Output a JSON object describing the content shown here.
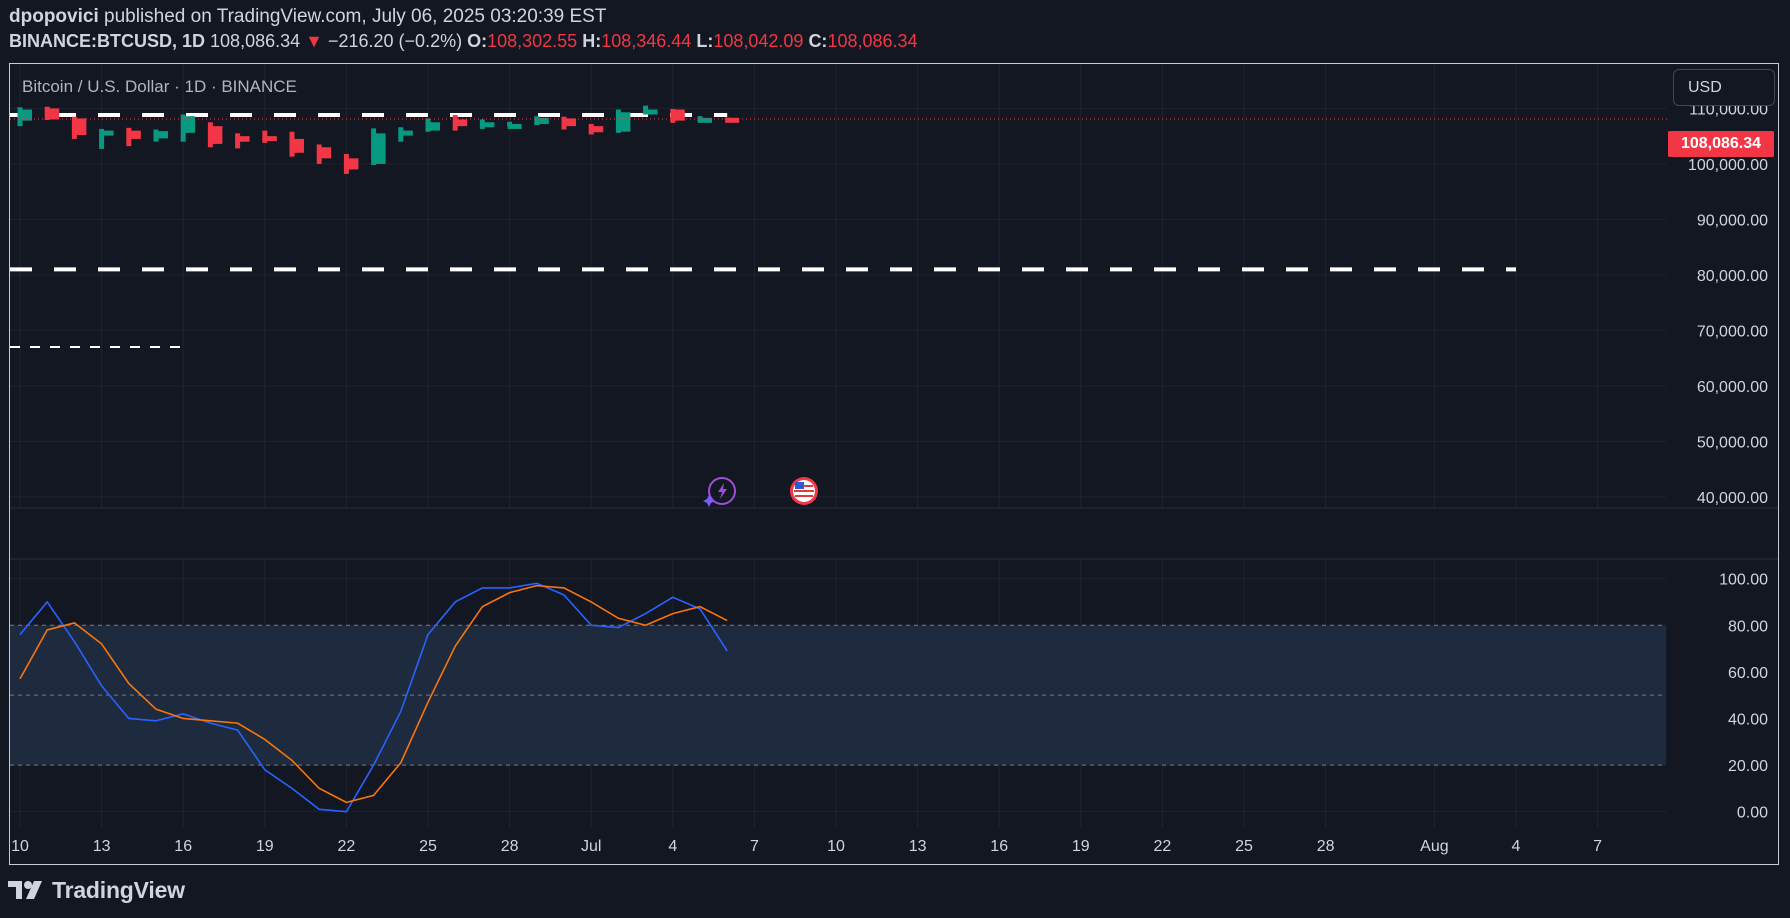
{
  "header": {
    "author": "dpopovici",
    "published_text": "published on TradingView.com, July 06, 2025 03:20:39 EST",
    "symbol": "BINANCE:BTCUSD, 1D",
    "last_price": "108,086.34",
    "arrow": "▼",
    "change": "−216.20 (−0.2%)",
    "open_label": "O:",
    "open": "108,302.55",
    "high_label": "H:",
    "high": "108,346.44",
    "low_label": "L:",
    "low": "108,042.09",
    "close_label": "C:",
    "close": "108,086.34"
  },
  "legend_title": "Bitcoin / U.S. Dollar · 1D · BINANCE",
  "currency_button": "USD",
  "price_tag": "108,086.34",
  "brand": "TradingView",
  "icons": {
    "event1": "lightning-sparkle-icon",
    "event2": "us-flag-icon",
    "logo": "tradingview-logo-icon"
  },
  "colors": {
    "background": "#131722",
    "up": "#089981",
    "down": "#f23645",
    "k_line": "#2962ff",
    "d_line": "#f7760d",
    "band": "#1e2a3d"
  },
  "chart_data": [
    {
      "type": "candlestick",
      "title": "",
      "y_ticks": [
        "110,000.00",
        "100,000.00",
        "90,000.00",
        "80,000.00",
        "70,000.00",
        "60,000.00",
        "50,000.00",
        "40,000.00"
      ],
      "y_tick_values": [
        110000,
        100000,
        90000,
        80000,
        70000,
        60000,
        50000,
        40000
      ],
      "ylim": [
        38000,
        118000
      ],
      "x_ticks": [
        "10",
        "13",
        "16",
        "19",
        "22",
        "25",
        "28",
        "Jul",
        "4",
        "7",
        "10",
        "13",
        "16",
        "19",
        "22",
        "25",
        "28",
        "Aug",
        "4",
        "7"
      ],
      "x_tick_days": [
        0,
        3,
        6,
        9,
        12,
        15,
        18,
        21,
        24,
        27,
        30,
        33,
        36,
        39,
        42,
        45,
        48,
        52,
        55,
        58
      ],
      "candles_start_day": 0,
      "candles": [
        {
          "o": 107800,
          "h": 110200,
          "l": 106800,
          "c": 109800
        },
        {
          "o": 110000,
          "h": 110300,
          "l": 107900,
          "c": 108000
        },
        {
          "o": 108200,
          "h": 108500,
          "l": 104500,
          "c": 105200
        },
        {
          "o": 105200,
          "h": 106300,
          "l": 102700,
          "c": 106000
        },
        {
          "o": 106000,
          "h": 106500,
          "l": 103200,
          "c": 104500
        },
        {
          "o": 104600,
          "h": 106200,
          "l": 104000,
          "c": 105900
        },
        {
          "o": 105600,
          "h": 108900,
          "l": 104000,
          "c": 108600
        },
        {
          "o": 106800,
          "h": 107500,
          "l": 103000,
          "c": 103600
        },
        {
          "o": 105000,
          "h": 105500,
          "l": 102800,
          "c": 104000
        },
        {
          "o": 105000,
          "h": 106000,
          "l": 103800,
          "c": 104200
        },
        {
          "o": 104500,
          "h": 105800,
          "l": 101300,
          "c": 102000
        },
        {
          "o": 103000,
          "h": 103500,
          "l": 100000,
          "c": 101000
        },
        {
          "o": 101000,
          "h": 101800,
          "l": 98200,
          "c": 99000
        },
        {
          "o": 100000,
          "h": 106400,
          "l": 99800,
          "c": 105500
        },
        {
          "o": 105500,
          "h": 106600,
          "l": 104000,
          "c": 106000
        },
        {
          "o": 106000,
          "h": 108200,
          "l": 105800,
          "c": 107500
        },
        {
          "o": 108000,
          "h": 108800,
          "l": 106000,
          "c": 106800
        },
        {
          "o": 106800,
          "h": 108000,
          "l": 106300,
          "c": 107500
        },
        {
          "o": 107000,
          "h": 107600,
          "l": 106800,
          "c": 107200
        },
        {
          "o": 107200,
          "h": 108600,
          "l": 107000,
          "c": 108300
        },
        {
          "o": 108200,
          "h": 108500,
          "l": 106200,
          "c": 106800
        },
        {
          "o": 106800,
          "h": 107200,
          "l": 105300,
          "c": 105700
        },
        {
          "o": 105800,
          "h": 109800,
          "l": 105600,
          "c": 109300
        },
        {
          "o": 109300,
          "h": 110500,
          "l": 108900,
          "c": 109800
        },
        {
          "o": 109800,
          "h": 109900,
          "l": 107400,
          "c": 107800
        },
        {
          "o": 107800,
          "h": 108600,
          "l": 107600,
          "c": 108300
        },
        {
          "o": 108302.55,
          "h": 108346.44,
          "l": 108042.09,
          "c": 108086.34
        }
      ],
      "dashed_levels": [
        {
          "value": 108800,
          "from_day": 0,
          "to_day": 26
        },
        {
          "value": 81000,
          "from_day": 0,
          "to_day": 55
        },
        {
          "value": 67000,
          "from_day": 0,
          "to_day": 6
        }
      ],
      "last_price": 108086.34
    },
    {
      "type": "line",
      "title": "",
      "y_ticks": [
        "100.00",
        "80.00",
        "60.00",
        "40.00",
        "20.00",
        "0.00"
      ],
      "y_tick_values": [
        100,
        80,
        60,
        40,
        20,
        0
      ],
      "ylim": [
        -7,
        108
      ],
      "band": [
        20,
        80
      ],
      "midline": 50,
      "series": [
        {
          "color": "#2962ff",
          "values": [
            76,
            90,
            73,
            54,
            40,
            39,
            42,
            38,
            35,
            18,
            10,
            1,
            0,
            20,
            43,
            76,
            90,
            96,
            96,
            98,
            93,
            80,
            79,
            85,
            92,
            87,
            69
          ]
        },
        {
          "color": "#f7760d",
          "values": [
            57,
            78,
            81,
            72,
            55,
            44,
            40,
            39,
            38,
            31,
            22,
            10,
            4,
            7,
            21,
            47,
            71,
            88,
            94,
            97,
            96,
            90,
            83,
            80,
            85,
            88,
            82
          ]
        }
      ]
    }
  ]
}
